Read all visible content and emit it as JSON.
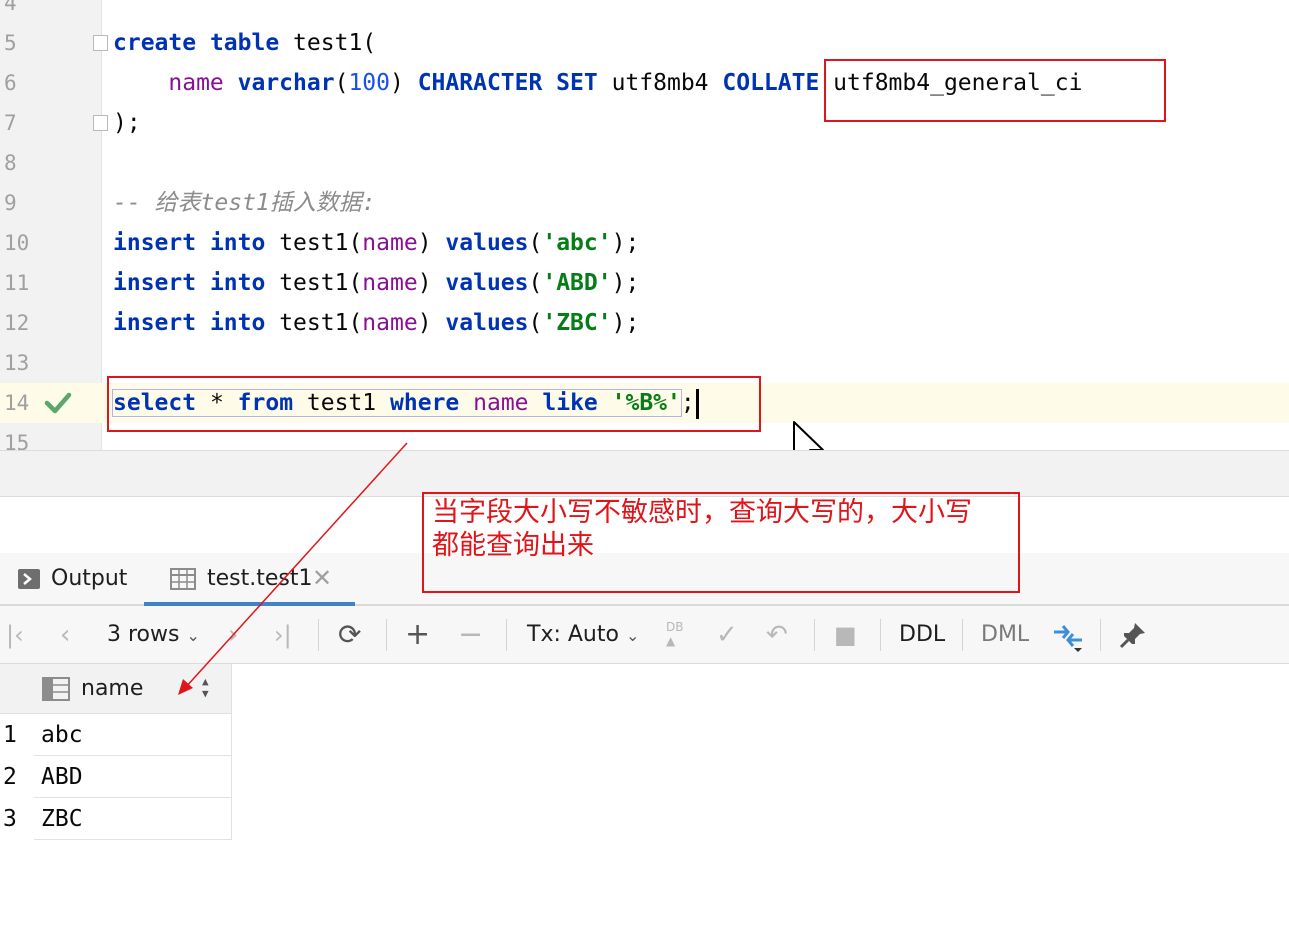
{
  "editor": {
    "lines": [
      {
        "no": "4"
      },
      {
        "no": "5"
      },
      {
        "no": "6"
      },
      {
        "no": "7"
      },
      {
        "no": "8"
      },
      {
        "no": "9"
      },
      {
        "no": "10"
      },
      {
        "no": "11"
      },
      {
        "no": "12"
      },
      {
        "no": "13"
      },
      {
        "no": "14"
      },
      {
        "no": "15"
      }
    ],
    "code": {
      "l5": {
        "kw1": "create",
        "kw2": "table",
        "rest": " test1("
      },
      "l6": {
        "fld": "name",
        "type": "varchar",
        "paren_open": "(",
        "num": "100",
        "paren_close": ")",
        "kw_cs": "CHARACTER SET",
        "cs": "utf8mb4",
        "kw_col": "COLLATE",
        "col": "utf8mb4_general_ci"
      },
      "l7": {
        "text": ");"
      },
      "l9": {
        "comment": "-- 给表test1插入数据:"
      },
      "l10": {
        "kw1": "insert",
        "kw2": "into",
        "tbl": "test1(",
        "fld": "name",
        "p": ")",
        "kw3": "values",
        "o": "(",
        "str": "'abc'",
        "e": ");"
      },
      "l11": {
        "kw1": "insert",
        "kw2": "into",
        "tbl": "test1(",
        "fld": "name",
        "p": ")",
        "kw3": "values",
        "o": "(",
        "str": "'ABD'",
        "e": ");"
      },
      "l12": {
        "kw1": "insert",
        "kw2": "into",
        "tbl": "test1(",
        "fld": "name",
        "p": ")",
        "kw3": "values",
        "o": "(",
        "str": "'ZBC'",
        "e": ");"
      },
      "l14": {
        "kw1": "select",
        "star": "*",
        "kw2": "from",
        "tbl": "test1",
        "kw3": "where",
        "fld": "name",
        "kw4": "like",
        "str": "'%B%'",
        "semi": ";"
      }
    }
  },
  "annotation": {
    "note": "当字段大小写不敏感时，查询大写的，大小写都能查询出来"
  },
  "tabs": {
    "output_label": "Output",
    "table_label": "test.test1"
  },
  "toolbar": {
    "rows_label": "3 rows",
    "tx_label": "Tx: Auto",
    "ddl_label": "DDL",
    "dml_label": "DML",
    "db_label": "DB"
  },
  "grid": {
    "column_header": "name",
    "rows": [
      {
        "n": "1",
        "name": "abc"
      },
      {
        "n": "2",
        "name": "ABD"
      },
      {
        "n": "3",
        "name": "ZBC"
      }
    ]
  },
  "colors": {
    "keyword": "#0033b3",
    "field": "#871094",
    "string": "#067d17",
    "number": "#1750eb",
    "comment": "#8c8c8c",
    "annotation": "#e0151a",
    "accent": "#4083c9"
  }
}
